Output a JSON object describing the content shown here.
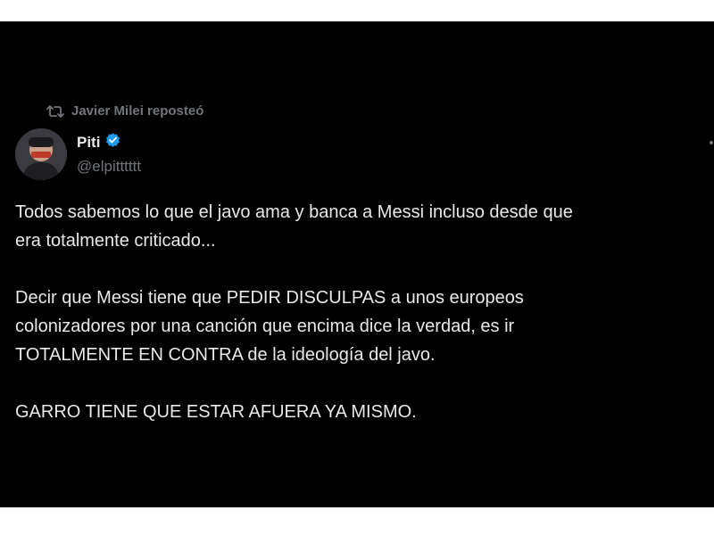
{
  "repost": {
    "icon": "repost-icon",
    "text": "Javier Milei reposteó"
  },
  "author": {
    "display_name": "Piti",
    "verified_icon": "verified-badge-icon",
    "handle": "@elpitttttt",
    "avatar_icon": "avatar-photo"
  },
  "more_icon": "more-options-icon",
  "tweet": {
    "paragraphs": [
      "Todos sabemos lo que el javo ama y banca a Messi incluso desde que\nera totalmente criticado...",
      "Decir que Messi tiene que PEDIR DISCULPAS a unos europeos\ncolonizadores por una canción que encima dice la verdad, es ir\nTOTALMENTE EN CONTRA de la ideología del javo.",
      "GARRO TIENE QUE ESTAR AFUERA YA MISMO."
    ]
  },
  "colors": {
    "background": "#000000",
    "text": "#e7e9ea",
    "muted": "#71767b",
    "verified": "#1d9bf0"
  }
}
